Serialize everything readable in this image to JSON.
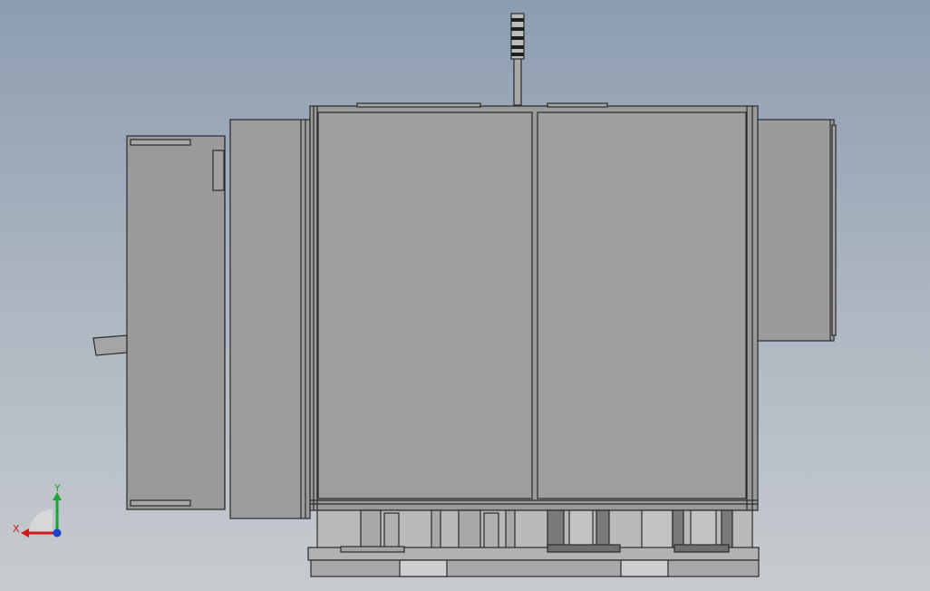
{
  "triad": {
    "x_label": "X",
    "y_label": "Y",
    "x_color": "#cc1b1b",
    "y_color": "#1ea335",
    "z_color": "#1f3fcf"
  },
  "colors": {
    "background_top": "#8d9db1",
    "background_bottom": "#c7cbcf",
    "panel_fill": "#9c9c9c",
    "edge": "#2b2b2b"
  }
}
